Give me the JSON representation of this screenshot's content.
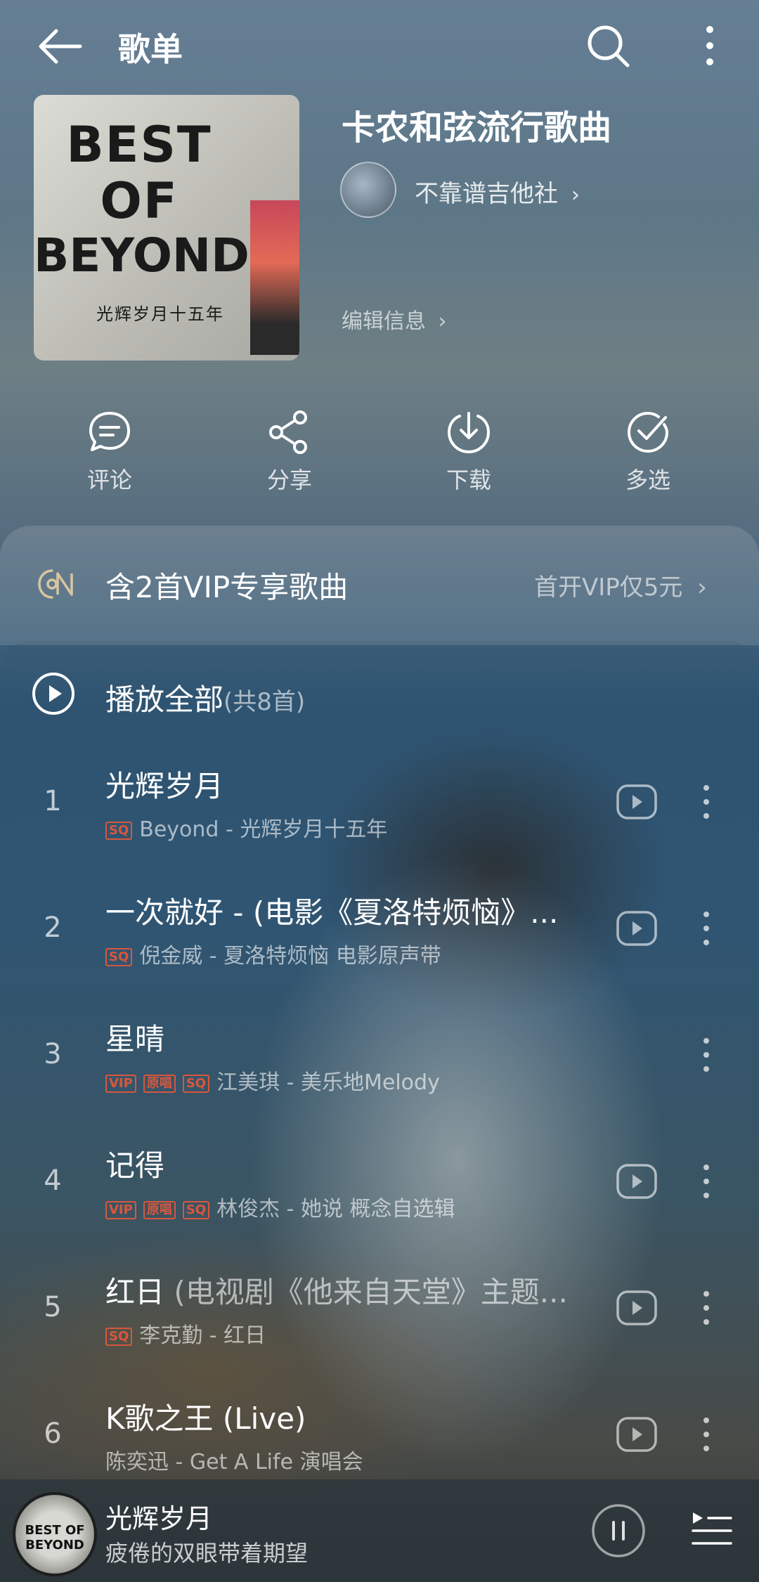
{
  "header": {
    "title": "歌单"
  },
  "playlist": {
    "cover_text": [
      "BEST",
      "OF",
      "BEYOND",
      "光辉岁月十五年"
    ],
    "name": "卡农和弦流行歌曲",
    "owner": "不靠谱吉他社",
    "edit_label": "编辑信息"
  },
  "actions": [
    {
      "label": "评论",
      "icon": "comment-icon"
    },
    {
      "label": "分享",
      "icon": "share-icon"
    },
    {
      "label": "下载",
      "icon": "download-icon"
    },
    {
      "label": "多选",
      "icon": "multi-select-icon"
    }
  ],
  "vip": {
    "text": "含2首VIP专享歌曲",
    "link": "首开VIP仅5元"
  },
  "play_all": {
    "label": "播放全部",
    "count": "(共8首)"
  },
  "songs": [
    {
      "num": "1",
      "title": "光辉岁月",
      "subtitle": "",
      "artist": "Beyond",
      "album": "光辉岁月十五年",
      "badges": [
        "SQ"
      ],
      "has_mv": true
    },
    {
      "num": "2",
      "title": "一次就好 - (电影《夏洛特烦恼》...",
      "subtitle": "",
      "artist": "倪金威",
      "album": "夏洛特烦恼 电影原声带",
      "badges": [
        "SQ"
      ],
      "has_mv": true
    },
    {
      "num": "3",
      "title": "星晴",
      "subtitle": "",
      "artist": "江美琪",
      "album": "美乐地Melody",
      "badges": [
        "VIP",
        "原唱",
        "SQ"
      ],
      "has_mv": false
    },
    {
      "num": "4",
      "title": "记得",
      "subtitle": "",
      "artist": "林俊杰",
      "album": "她说 概念自选辑",
      "badges": [
        "VIP",
        "原唱",
        "SQ"
      ],
      "has_mv": true
    },
    {
      "num": "5",
      "title": "红日",
      "subtitle": "(电视剧《他来自天堂》主题...",
      "artist": "李克勤",
      "album": "红日",
      "badges": [
        "SQ"
      ],
      "has_mv": true
    },
    {
      "num": "6",
      "title": "K歌之王 (Live)",
      "subtitle": "",
      "artist": "陈奕迅",
      "album": "Get A Life 演唱会",
      "badges": [],
      "has_mv": true
    }
  ],
  "player": {
    "cover_text": "BEST OF BEYOND",
    "title": "光辉岁月",
    "lyric": "疲倦的双眼带着期望"
  },
  "colors": {
    "badge": "#d8573c",
    "text": "#ffffff"
  }
}
